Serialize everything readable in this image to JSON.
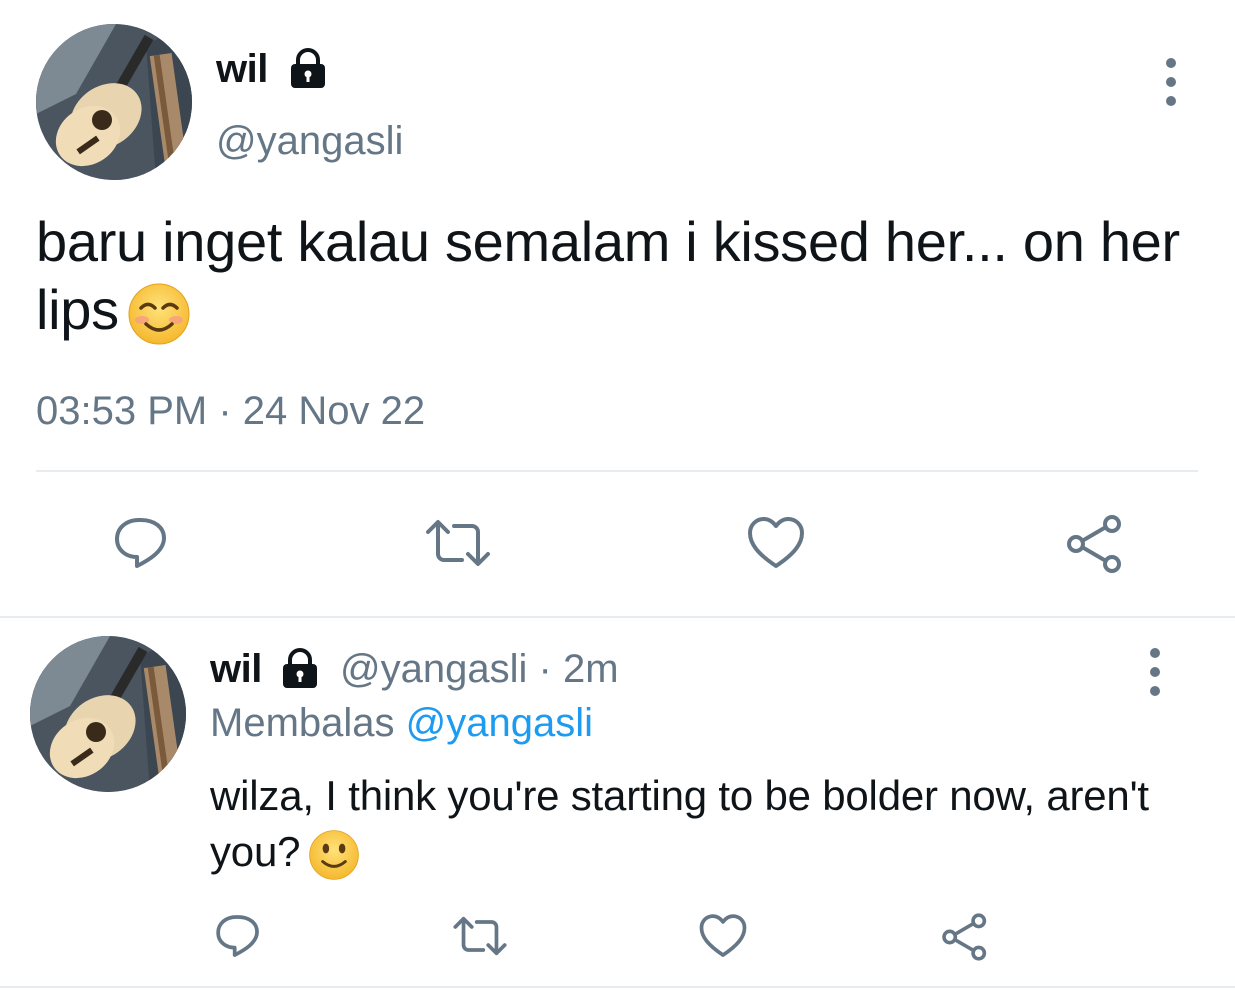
{
  "main_tweet": {
    "display_name": "wil",
    "handle": "@yangasli",
    "text": "baru inget kalau semalam i kissed her... on her lips",
    "emoji": "smiling-face-with-smiling-eyes",
    "time": "03:53 PM",
    "separator": "·",
    "date": "24 Nov 22"
  },
  "reply": {
    "display_name": "wil",
    "handle": "@yangasli",
    "separator": "·",
    "age": "2m",
    "replying_prefix": "Membalas",
    "replying_to": "@yangasli",
    "text": "wilza, I think you're starting to be bolder now, aren't you?",
    "emoji": "slightly-smiling-face"
  },
  "icons": {
    "reply": "reply-icon",
    "retweet": "retweet-icon",
    "like": "heart-icon",
    "share": "share-icon",
    "more": "more-vertical-icon",
    "lock": "lock-icon"
  },
  "colors": {
    "text": "#0f1419",
    "muted": "#657786",
    "link": "#1d9bf0",
    "divider": "#e6ecf0"
  }
}
